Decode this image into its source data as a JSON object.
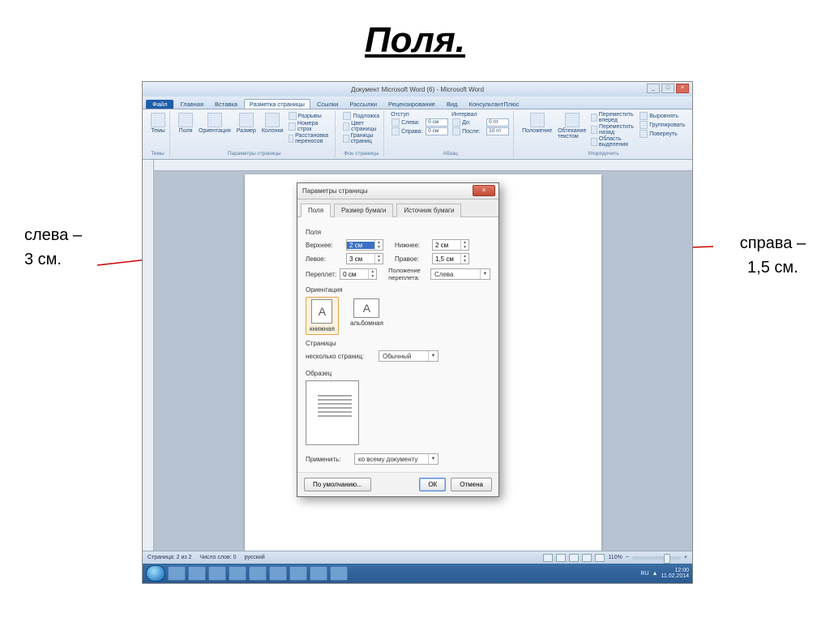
{
  "slide": {
    "title": "Поля.",
    "annot_left_1": "слева –",
    "annot_left_2": "3 см.",
    "annot_right_1": "справа –",
    "annot_right_2": "1,5 см."
  },
  "word": {
    "title": "Документ Microsoft Word (6) - Microsoft Word",
    "tabs": {
      "file": "Файл",
      "home": "Главная",
      "insert": "Вставка",
      "layout": "Разметка страницы",
      "refs": "Ссылки",
      "mail": "Рассылки",
      "review": "Рецензирование",
      "view": "Вид",
      "consult": "КонсультантПлюс"
    },
    "ribbon": {
      "themes": "Темы",
      "margins": "Поля",
      "orientation": "Ориентация",
      "size": "Размер",
      "columns": "Колонки",
      "breaks": "Разрывы",
      "lines": "Номера строк",
      "hyphen": "Расстановка переносов",
      "group1": "Параметры страницы",
      "watermark": "Подложка",
      "pagecolor": "Цвет страницы",
      "borders": "Границы страниц",
      "group2": "Фон страницы",
      "indent": "Отступ",
      "left_l": "Слева:",
      "right_l": "Справа:",
      "left_v": "0 см",
      "right_v": "0 см",
      "spacing": "Интервал",
      "before_l": "До:",
      "after_l": "После:",
      "before_v": "0 пт",
      "after_v": "10 пт",
      "group3": "Абзац",
      "position": "Положение",
      "wrap": "Обтекание текстом",
      "forward": "Переместить вперед",
      "backward": "Переместить назад",
      "selpane": "Область выделения",
      "align": "Выровнять",
      "group": "Группировать",
      "rotate": "Повернуть",
      "group4": "Упорядочить"
    },
    "status": {
      "page": "Страница: 2 из 2",
      "words": "Число слов: 0",
      "lang": "русский",
      "zoom": "110%"
    },
    "tray": {
      "lang": "RU",
      "time": "12:00",
      "date": "11.02.2014"
    }
  },
  "dialog": {
    "title": "Параметры страницы",
    "tabs": {
      "margins": "Поля",
      "paper": "Размер бумаги",
      "source": "Источник бумаги"
    },
    "section_margins": "Поля",
    "top_l": "Верхнее:",
    "top_v": "2 см",
    "bottom_l": "Нижнее:",
    "bottom_v": "2 см",
    "left_l": "Левое:",
    "left_v": "3 см",
    "right_l": "Правое:",
    "right_v": "1,5 см",
    "gutter_l": "Переплет:",
    "gutter_v": "0 см",
    "gutterpos_l": "Положение переплета:",
    "gutterpos_v": "Слева",
    "section_orient": "Ориентация",
    "portrait": "книжная",
    "landscape": "альбомная",
    "section_pages": "Страницы",
    "multi_l": "несколько страниц:",
    "multi_v": "Обычный",
    "section_preview": "Образец",
    "apply_l": "Применить:",
    "apply_v": "ко всему документу",
    "default_btn": "По умолчанию...",
    "ok": "ОК",
    "cancel": "Отмена"
  }
}
